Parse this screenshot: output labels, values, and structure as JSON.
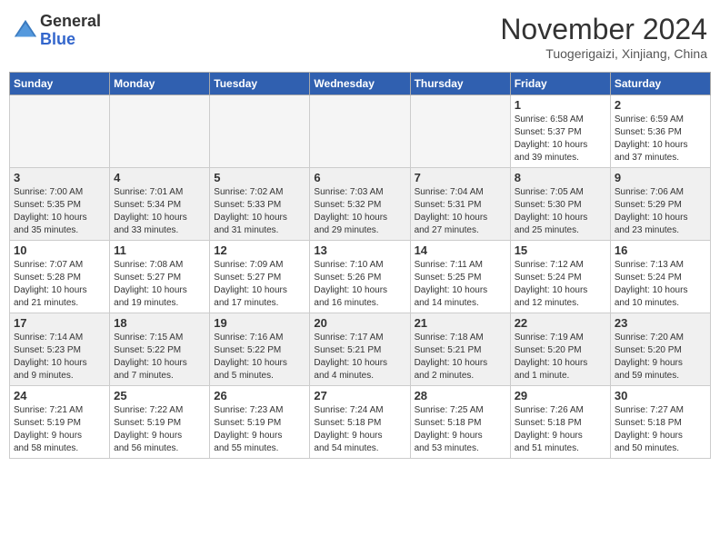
{
  "header": {
    "logo_line1": "General",
    "logo_line2": "Blue",
    "month_title": "November 2024",
    "location": "Tuogerigaizi, Xinjiang, China"
  },
  "calendar": {
    "days_of_week": [
      "Sunday",
      "Monday",
      "Tuesday",
      "Wednesday",
      "Thursday",
      "Friday",
      "Saturday"
    ],
    "weeks": [
      [
        {
          "day": "",
          "info": ""
        },
        {
          "day": "",
          "info": ""
        },
        {
          "day": "",
          "info": ""
        },
        {
          "day": "",
          "info": ""
        },
        {
          "day": "",
          "info": ""
        },
        {
          "day": "1",
          "info": "Sunrise: 6:58 AM\nSunset: 5:37 PM\nDaylight: 10 hours\nand 39 minutes."
        },
        {
          "day": "2",
          "info": "Sunrise: 6:59 AM\nSunset: 5:36 PM\nDaylight: 10 hours\nand 37 minutes."
        }
      ],
      [
        {
          "day": "3",
          "info": "Sunrise: 7:00 AM\nSunset: 5:35 PM\nDaylight: 10 hours\nand 35 minutes."
        },
        {
          "day": "4",
          "info": "Sunrise: 7:01 AM\nSunset: 5:34 PM\nDaylight: 10 hours\nand 33 minutes."
        },
        {
          "day": "5",
          "info": "Sunrise: 7:02 AM\nSunset: 5:33 PM\nDaylight: 10 hours\nand 31 minutes."
        },
        {
          "day": "6",
          "info": "Sunrise: 7:03 AM\nSunset: 5:32 PM\nDaylight: 10 hours\nand 29 minutes."
        },
        {
          "day": "7",
          "info": "Sunrise: 7:04 AM\nSunset: 5:31 PM\nDaylight: 10 hours\nand 27 minutes."
        },
        {
          "day": "8",
          "info": "Sunrise: 7:05 AM\nSunset: 5:30 PM\nDaylight: 10 hours\nand 25 minutes."
        },
        {
          "day": "9",
          "info": "Sunrise: 7:06 AM\nSunset: 5:29 PM\nDaylight: 10 hours\nand 23 minutes."
        }
      ],
      [
        {
          "day": "10",
          "info": "Sunrise: 7:07 AM\nSunset: 5:28 PM\nDaylight: 10 hours\nand 21 minutes."
        },
        {
          "day": "11",
          "info": "Sunrise: 7:08 AM\nSunset: 5:27 PM\nDaylight: 10 hours\nand 19 minutes."
        },
        {
          "day": "12",
          "info": "Sunrise: 7:09 AM\nSunset: 5:27 PM\nDaylight: 10 hours\nand 17 minutes."
        },
        {
          "day": "13",
          "info": "Sunrise: 7:10 AM\nSunset: 5:26 PM\nDaylight: 10 hours\nand 16 minutes."
        },
        {
          "day": "14",
          "info": "Sunrise: 7:11 AM\nSunset: 5:25 PM\nDaylight: 10 hours\nand 14 minutes."
        },
        {
          "day": "15",
          "info": "Sunrise: 7:12 AM\nSunset: 5:24 PM\nDaylight: 10 hours\nand 12 minutes."
        },
        {
          "day": "16",
          "info": "Sunrise: 7:13 AM\nSunset: 5:24 PM\nDaylight: 10 hours\nand 10 minutes."
        }
      ],
      [
        {
          "day": "17",
          "info": "Sunrise: 7:14 AM\nSunset: 5:23 PM\nDaylight: 10 hours\nand 9 minutes."
        },
        {
          "day": "18",
          "info": "Sunrise: 7:15 AM\nSunset: 5:22 PM\nDaylight: 10 hours\nand 7 minutes."
        },
        {
          "day": "19",
          "info": "Sunrise: 7:16 AM\nSunset: 5:22 PM\nDaylight: 10 hours\nand 5 minutes."
        },
        {
          "day": "20",
          "info": "Sunrise: 7:17 AM\nSunset: 5:21 PM\nDaylight: 10 hours\nand 4 minutes."
        },
        {
          "day": "21",
          "info": "Sunrise: 7:18 AM\nSunset: 5:21 PM\nDaylight: 10 hours\nand 2 minutes."
        },
        {
          "day": "22",
          "info": "Sunrise: 7:19 AM\nSunset: 5:20 PM\nDaylight: 10 hours\nand 1 minute."
        },
        {
          "day": "23",
          "info": "Sunrise: 7:20 AM\nSunset: 5:20 PM\nDaylight: 9 hours\nand 59 minutes."
        }
      ],
      [
        {
          "day": "24",
          "info": "Sunrise: 7:21 AM\nSunset: 5:19 PM\nDaylight: 9 hours\nand 58 minutes."
        },
        {
          "day": "25",
          "info": "Sunrise: 7:22 AM\nSunset: 5:19 PM\nDaylight: 9 hours\nand 56 minutes."
        },
        {
          "day": "26",
          "info": "Sunrise: 7:23 AM\nSunset: 5:19 PM\nDaylight: 9 hours\nand 55 minutes."
        },
        {
          "day": "27",
          "info": "Sunrise: 7:24 AM\nSunset: 5:18 PM\nDaylight: 9 hours\nand 54 minutes."
        },
        {
          "day": "28",
          "info": "Sunrise: 7:25 AM\nSunset: 5:18 PM\nDaylight: 9 hours\nand 53 minutes."
        },
        {
          "day": "29",
          "info": "Sunrise: 7:26 AM\nSunset: 5:18 PM\nDaylight: 9 hours\nand 51 minutes."
        },
        {
          "day": "30",
          "info": "Sunrise: 7:27 AM\nSunset: 5:18 PM\nDaylight: 9 hours\nand 50 minutes."
        }
      ]
    ]
  }
}
